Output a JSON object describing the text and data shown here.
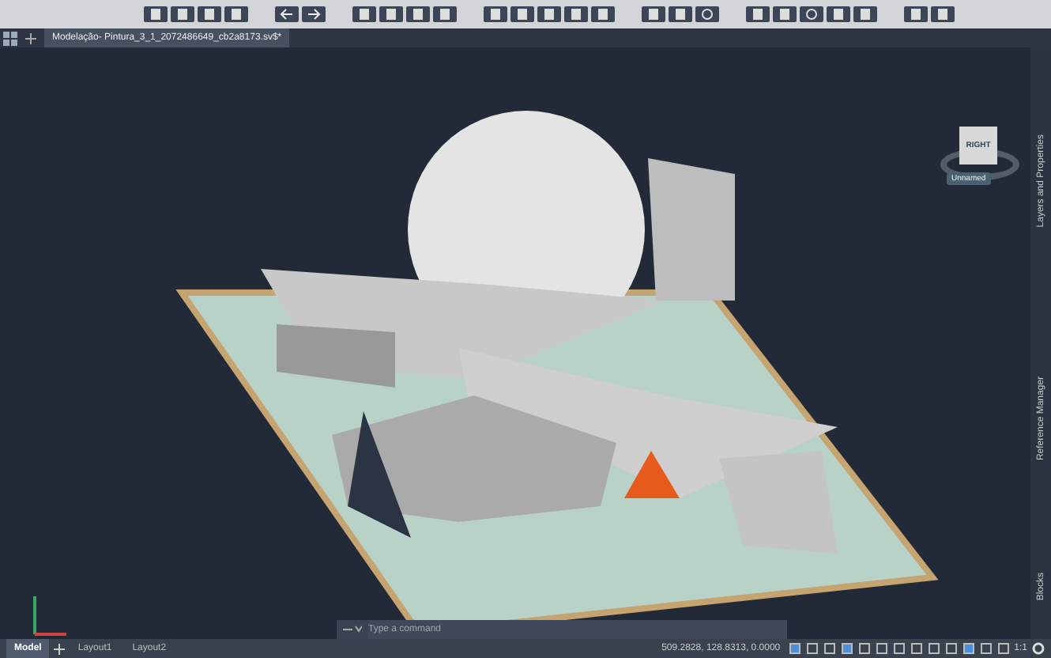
{
  "document_tab": {
    "title": "Modelação- Pintura_3_1_2072486649_cb2a8173.sv$*",
    "selected": true
  },
  "viewcube": {
    "face": "RIGHT",
    "ucs": "Unnamed"
  },
  "palettes": [
    {
      "label": "Layers and Properties"
    },
    {
      "label": "Reference Manager"
    },
    {
      "label": "Blocks"
    }
  ],
  "command_line": {
    "placeholder": "Type a command"
  },
  "layout_tabs": [
    {
      "label": "Model",
      "selected": true
    },
    {
      "label": "Layout1",
      "selected": false
    },
    {
      "label": "Layout2",
      "selected": false
    }
  ],
  "status_bar": {
    "coordinates": "509.2828, 128.8313, 0.0000",
    "scale": "1:1"
  }
}
